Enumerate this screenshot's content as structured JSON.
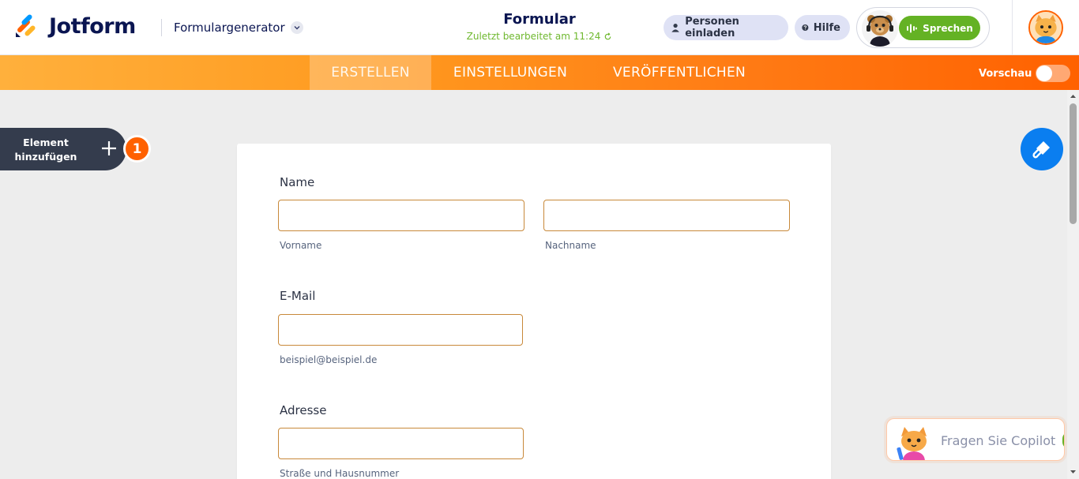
{
  "header": {
    "logo_text": "Jotform",
    "generator_label": "Formulargenerator",
    "form_title": "Formular",
    "last_edited": "Zuletzt bearbeitet am 11:24",
    "invite_label": "Personen einladen",
    "help_label": "Hilfe",
    "speak_label": "Sprechen"
  },
  "nav": {
    "tabs": [
      {
        "label": "ERSTELLEN",
        "active": true
      },
      {
        "label": "EINSTELLUNGEN",
        "active": false
      },
      {
        "label": "VERÖFFENTLICHEN",
        "active": false
      }
    ],
    "preview_label": "Vorschau",
    "preview_on": false
  },
  "add_element": {
    "label_line1": "Element",
    "label_line2": "hinzufügen",
    "badge": "1"
  },
  "form": {
    "name": {
      "label": "Name",
      "first_sublabel": "Vorname",
      "last_sublabel": "Nachname"
    },
    "email": {
      "label": "E-Mail",
      "sublabel": "beispiel@beispiel.de"
    },
    "address": {
      "label": "Adresse",
      "sublabel": "Straße und Hausnummer"
    }
  },
  "copilot": {
    "label": "Fragen Sie Copilot"
  },
  "colors": {
    "accent_orange": "#ff6100",
    "navy": "#0a1551",
    "green": "#64b224",
    "blue": "#0a7ef0",
    "input_border": "#c8893a"
  }
}
